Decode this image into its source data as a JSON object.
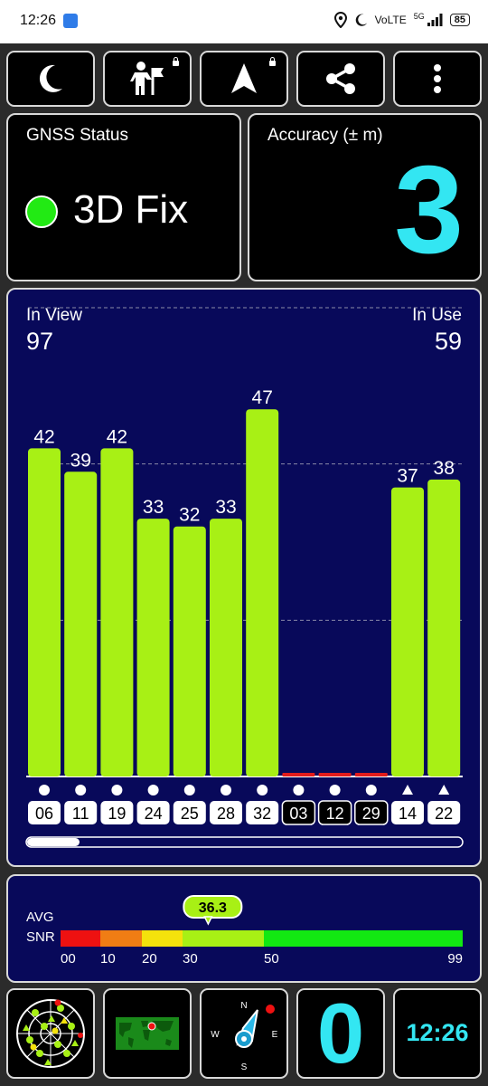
{
  "status_bar": {
    "time": "12:26",
    "network": "VoLTE",
    "network_gen": "5G",
    "battery": "85"
  },
  "toolbar": {
    "buttons": [
      {
        "icon": "moon-icon",
        "locked": false
      },
      {
        "icon": "person-flag-icon",
        "locked": true
      },
      {
        "icon": "navigation-arrow-icon",
        "locked": true
      },
      {
        "icon": "share-icon",
        "locked": false
      },
      {
        "icon": "more-vert-icon",
        "locked": false
      }
    ]
  },
  "gnss_status": {
    "title": "GNSS Status",
    "fix": "3D Fix",
    "fix_color": "#22ea14"
  },
  "accuracy": {
    "title": "Accuracy (± m)",
    "value": "3",
    "color": "#33e6f2"
  },
  "satellites": {
    "in_view_label": "In View",
    "in_view": "97",
    "in_use_label": "In Use",
    "in_use": "59"
  },
  "chart_data": {
    "type": "bar",
    "categories": [
      "06",
      "11",
      "19",
      "24",
      "25",
      "28",
      "32",
      "03",
      "12",
      "29",
      "14",
      "22"
    ],
    "values": [
      42,
      39,
      42,
      33,
      32,
      33,
      47,
      0,
      0,
      0,
      37,
      38
    ],
    "labels_shown": [
      true,
      true,
      true,
      true,
      true,
      true,
      true,
      false,
      false,
      false,
      true,
      true
    ],
    "marker": [
      "circle",
      "circle",
      "circle",
      "circle",
      "circle",
      "circle",
      "circle",
      "circle",
      "circle",
      "circle",
      "triangle",
      "triangle"
    ],
    "used": [
      true,
      true,
      true,
      true,
      true,
      true,
      true,
      false,
      false,
      true,
      true,
      true
    ],
    "ylim": [
      0,
      60
    ],
    "gridlines": [
      20,
      40,
      60
    ],
    "colors": {
      "good": "#a8f015",
      "zero": "#e31b1b"
    },
    "scroll_fraction": 0.12
  },
  "snr_scale": {
    "label_line1": "AVG",
    "label_line2": "SNR",
    "avg": "36.3",
    "avg_value": 36.3,
    "scale_max": 99,
    "segments": [
      {
        "from": 0,
        "to": 10,
        "color": "#ee1111"
      },
      {
        "from": 10,
        "to": 20,
        "color": "#f07d14"
      },
      {
        "from": 20,
        "to": 30,
        "color": "#f4e20c"
      },
      {
        "from": 30,
        "to": 50,
        "color": "#a8f015"
      },
      {
        "from": 50,
        "to": 99,
        "color": "#12e812"
      }
    ],
    "ticks": [
      {
        "label": "00",
        "value": 0
      },
      {
        "label": "10",
        "value": 10
      },
      {
        "label": "20",
        "value": 20
      },
      {
        "label": "30",
        "value": 30
      },
      {
        "label": "50",
        "value": 50
      },
      {
        "label": "99",
        "value": 99
      }
    ]
  },
  "bottom_tiles": {
    "compass": {
      "n": "N",
      "s": "S",
      "e": "E",
      "w": "W"
    },
    "zero_value": "0",
    "zero_color": "#33e6f2",
    "clock": "12:26",
    "clock_color": "#33e6f2"
  }
}
